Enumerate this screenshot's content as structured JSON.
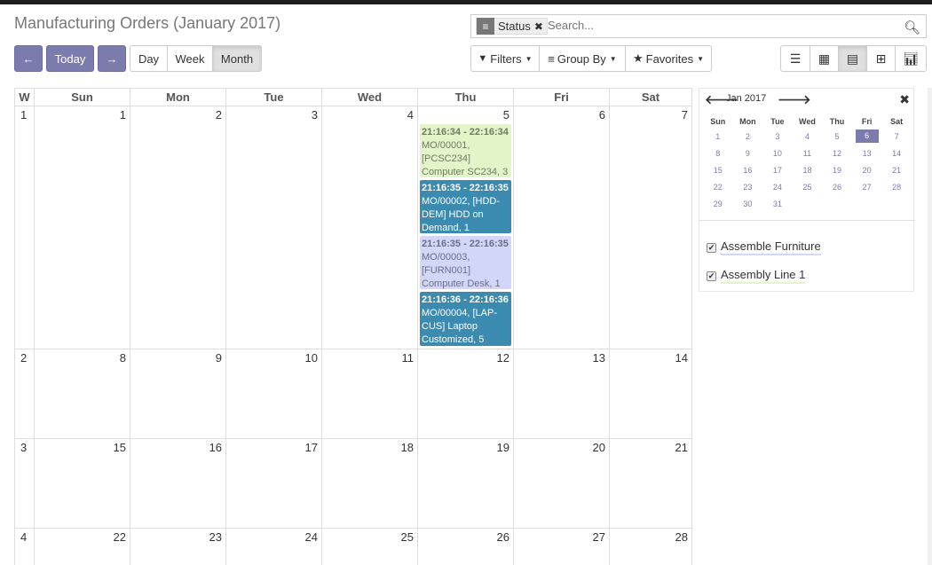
{
  "title": "Manufacturing Orders (January 2017)",
  "search": {
    "facet_label": "Status",
    "placeholder": "Search..."
  },
  "nav": {
    "prev": "←",
    "today": "Today",
    "next": "→"
  },
  "scale": {
    "day": "Day",
    "week": "Week",
    "month": "Month"
  },
  "filters": {
    "filters": "Filters",
    "group_by": "Group By",
    "favorites": "Favorites"
  },
  "views": [
    "list-view-icon",
    "kanban-view-icon",
    "calendar-view-icon",
    "pivot-view-icon",
    "graph-view-icon"
  ],
  "calendar": {
    "headers": [
      "W",
      "Sun",
      "Mon",
      "Tue",
      "Wed",
      "Thu",
      "Fri",
      "Sat"
    ],
    "weeks": [
      {
        "w": "1",
        "days": [
          "1",
          "2",
          "3",
          "4",
          "5",
          "6",
          "7"
        ]
      },
      {
        "w": "2",
        "days": [
          "8",
          "9",
          "10",
          "11",
          "12",
          "13",
          "14"
        ]
      },
      {
        "w": "3",
        "days": [
          "15",
          "16",
          "17",
          "18",
          "19",
          "20",
          "21"
        ]
      },
      {
        "w": "4",
        "days": [
          "22",
          "23",
          "24",
          "25",
          "26",
          "27",
          "28"
        ]
      }
    ],
    "events": [
      {
        "time": "21:16:34 - 22:16:34",
        "text": "MO/00001, [PCSC234] Computer SC234, 3",
        "bg": "#e3f5c8",
        "fg": "#6e7a63"
      },
      {
        "time": "21:16:35 - 22:16:35",
        "text": "MO/00002, [HDD-DEM] HDD on Demand, 1",
        "bg": "#3b8bb0",
        "fg": "#ffffff"
      },
      {
        "time": "21:16:35 - 22:16:35",
        "text": "MO/00003, [FURN001] Computer Desk, 1",
        "bg": "#d2d6f9",
        "fg": "#6b6e84"
      },
      {
        "time": "21:16:36 - 22:16:36",
        "text": "MO/00004, [LAP-CUS] Laptop Customized, 5",
        "bg": "#3b8bb0",
        "fg": "#ffffff"
      }
    ]
  },
  "mini": {
    "label": "Jan 2017",
    "headers": [
      "Sun",
      "Mon",
      "Tue",
      "Wed",
      "Thu",
      "Fri",
      "Sat"
    ],
    "rows": [
      [
        "1",
        "2",
        "3",
        "4",
        "5",
        "6",
        "7"
      ],
      [
        "8",
        "9",
        "10",
        "11",
        "12",
        "13",
        "14"
      ],
      [
        "15",
        "16",
        "17",
        "18",
        "19",
        "20",
        "21"
      ],
      [
        "22",
        "23",
        "24",
        "25",
        "26",
        "27",
        "28"
      ],
      [
        "29",
        "30",
        "31",
        "",
        "",
        "",
        ""
      ]
    ],
    "selected": "6"
  },
  "legend": [
    {
      "label": "Assemble Furniture",
      "underline": "#d2d6f9"
    },
    {
      "label": "Assembly Line 1",
      "underline": "#e3f5c8"
    }
  ]
}
